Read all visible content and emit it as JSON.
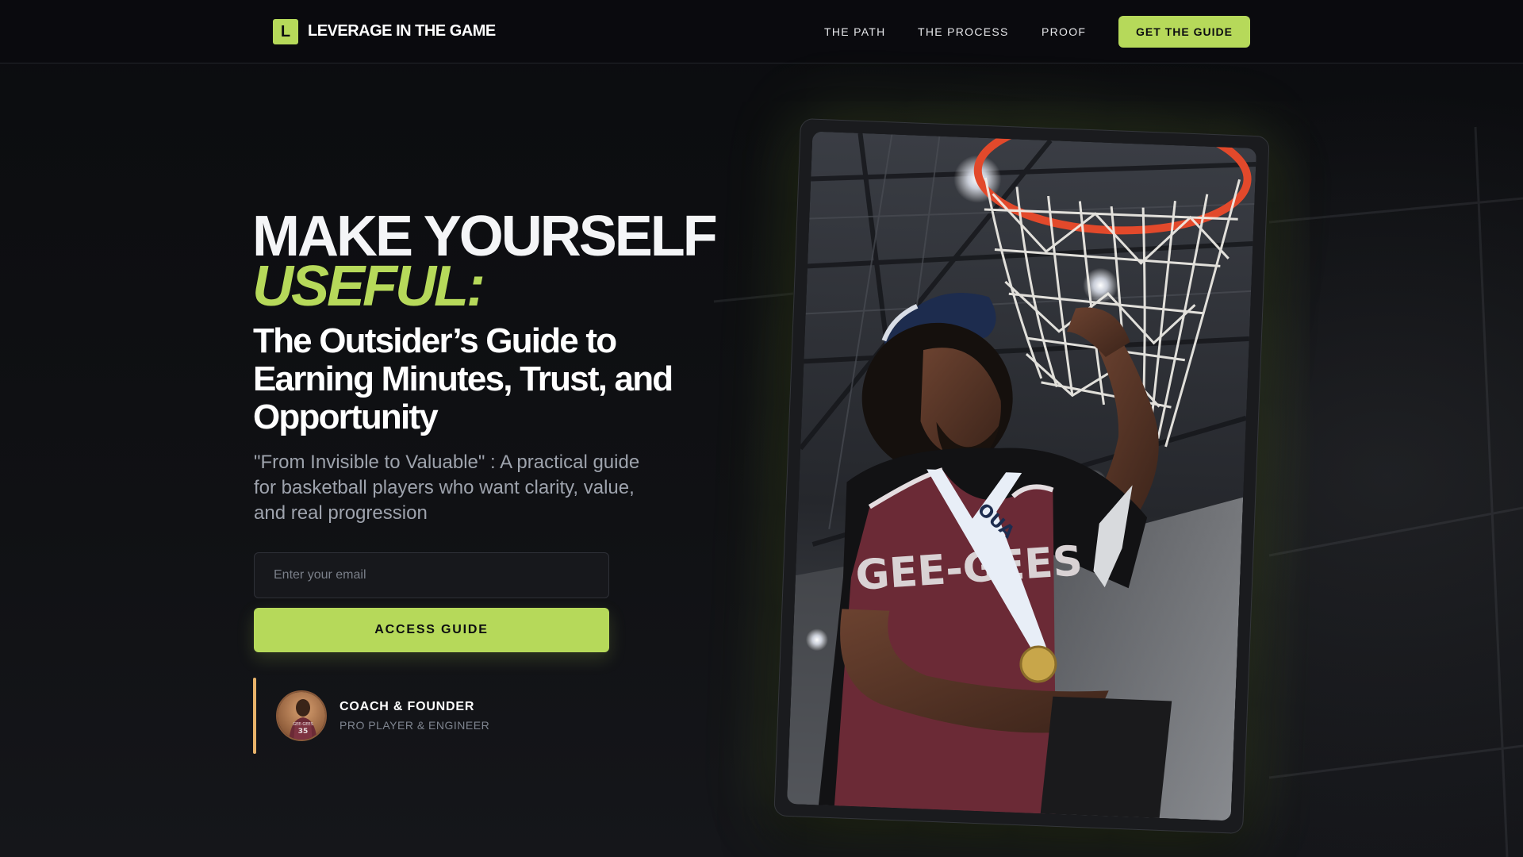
{
  "brand": {
    "logo_letter": "L",
    "name": "LEVERAGE IN THE GAME"
  },
  "nav": {
    "links": [
      "THE PATH",
      "THE PROCESS",
      "PROOF"
    ],
    "cta_label": "GET THE GUIDE"
  },
  "hero": {
    "headline_line1": "MAKE YOURSELF",
    "headline_line2": "USEFUL:",
    "subtitle": "The Outsider’s Guide to Earning Minutes, Trust, and Opportunity",
    "tagline": "\"From Invisible to Valuable\" : A practical guide for basketball players who want clarity, value, and real progression",
    "email_placeholder": "Enter your email",
    "email_value": "",
    "submit_label": "ACCESS GUIDE"
  },
  "founder": {
    "title": "COACH & FOUNDER",
    "subtitle": "PRO PLAYER & ENGINEER",
    "jersey_number": "35"
  },
  "photo": {
    "description_icon": "basketball-player-cutting-net-photo",
    "jersey_text": "GEE-GEES",
    "medal_ribbon_text": "OUA"
  },
  "colors": {
    "accent": "#b6d95a",
    "background": "#0c0d10",
    "founder_bar": "#e8b36a",
    "muted_text": "#9ea3ad",
    "jersey": "#6b2a36",
    "rim": "#e2492b"
  }
}
